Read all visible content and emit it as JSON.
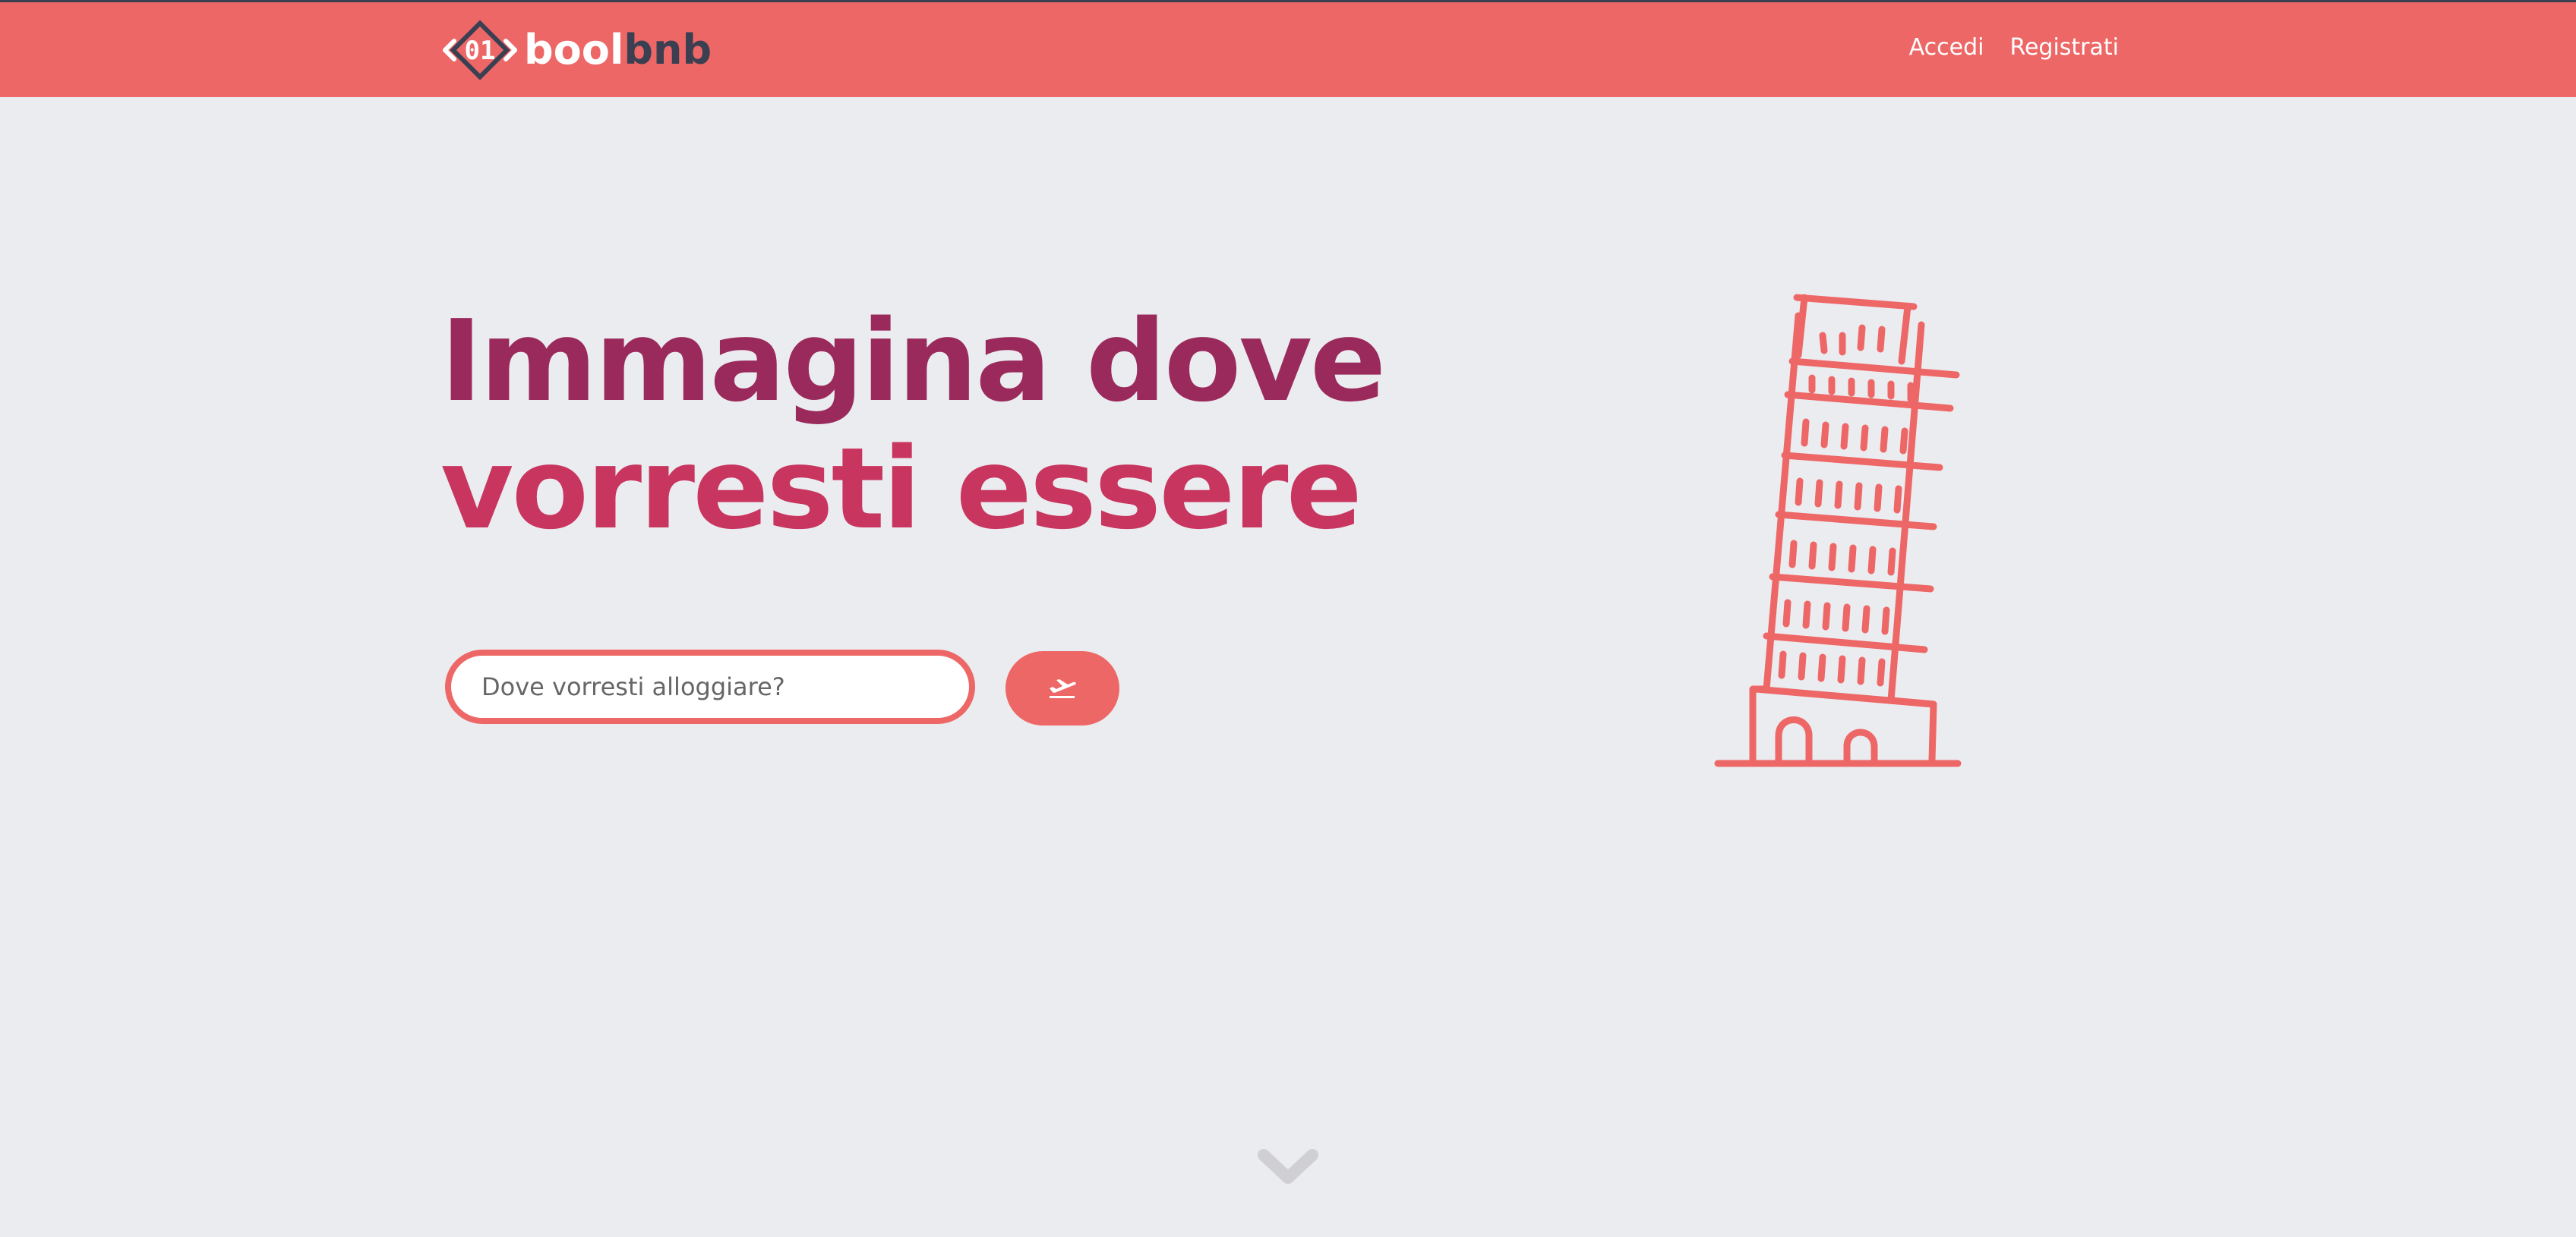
{
  "brand": {
    "mark_text": "01",
    "name_part1": "bool",
    "name_part2": "bnb",
    "colors": {
      "primary": "#ee6767",
      "dark": "#3a3f52"
    }
  },
  "nav": {
    "links": [
      {
        "label": "Accedi"
      },
      {
        "label": "Registrati"
      }
    ]
  },
  "hero": {
    "title_line1": "Immagina dove",
    "title_line2": "vorresti essere",
    "title_colors": [
      "#9a2a5c",
      "#c8355f"
    ],
    "illustration": "leaning-tower-of-pisa-icon"
  },
  "search": {
    "placeholder": "Dove vorresti alloggiare?",
    "value": "",
    "button_icon": "plane-departure-icon"
  },
  "scroll": {
    "icon": "chevron-down-icon"
  }
}
